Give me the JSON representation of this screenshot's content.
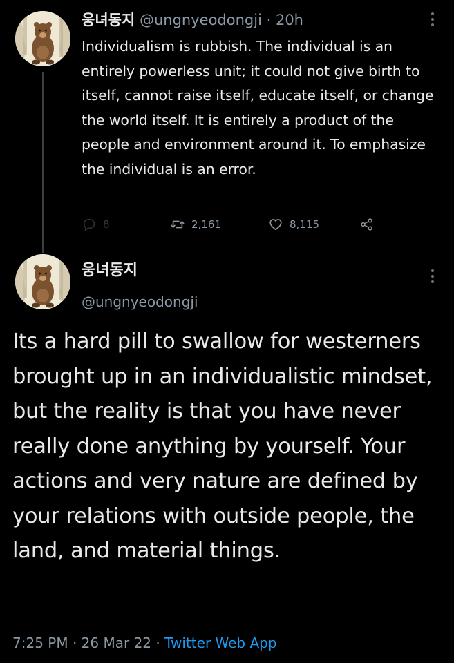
{
  "tweet1": {
    "display_name": "웅녀동지",
    "handle": "@ungnyeodongji",
    "separator": " · ",
    "time_ago": "20h",
    "text": "Individualism is rubbish. The individual is an entirely powerless unit; it could not give birth to itself, cannot raise itself, educate itself, or change the world itself. It is entirely a product of the people and environment around it. To emphasize the individual is an error.",
    "reply_count": "8",
    "retweet_count": "2,161",
    "like_count": "8,115",
    "icons": [
      "reply-icon",
      "retweet-icon",
      "like-icon",
      "share-icon",
      "more-icon"
    ]
  },
  "tweet2": {
    "display_name": "웅녀동지",
    "handle": "@ungnyeodongji",
    "text": "Its a hard pill to swallow for westerners brought up in an individualistic mindset, but the reality is that you have never really done anything by yourself. Your actions and very nature are defined by your relations with outside people, the land, and material things.",
    "time": "7:25 PM",
    "dot": " · ",
    "date": "26 Mar 22",
    "dot2": " · ",
    "source": "Twitter Web App"
  },
  "colors": {
    "background": "#000000",
    "text": "#e7e9ea",
    "muted": "#8b98a5",
    "link": "#1d9bf0",
    "thread_line": "#3a3f44"
  }
}
